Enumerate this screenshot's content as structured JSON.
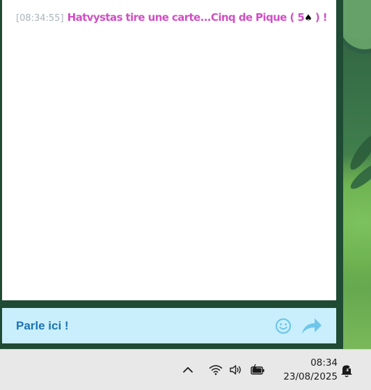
{
  "chat": {
    "messages": [
      {
        "time": "[08:34:55]",
        "text_before": "Hatvystas tire une carte...Cinq de Pique ( 5",
        "suit": "♠",
        "text_after": " ) !",
        "color": "#d14fc4"
      }
    ],
    "input": {
      "placeholder": "Parle ici !",
      "value": ""
    },
    "emoji_icon": "smiley-icon",
    "send_icon": "share-arrow-icon"
  },
  "taskbar": {
    "clock": {
      "time": "08:34",
      "date": "23/08/2025"
    },
    "tray_icons": [
      "chevron-up-icon",
      "wifi-icon",
      "volume-icon",
      "battery-icon",
      "notification-bell-icon"
    ]
  },
  "colors": {
    "chat_background": "#ffffff",
    "input_background": "#c9effc",
    "input_text": "#1b73b3",
    "message_text": "#d14fc4",
    "timestamp_text": "#a9b4bb",
    "taskbar_background": "#e8e8e8"
  }
}
